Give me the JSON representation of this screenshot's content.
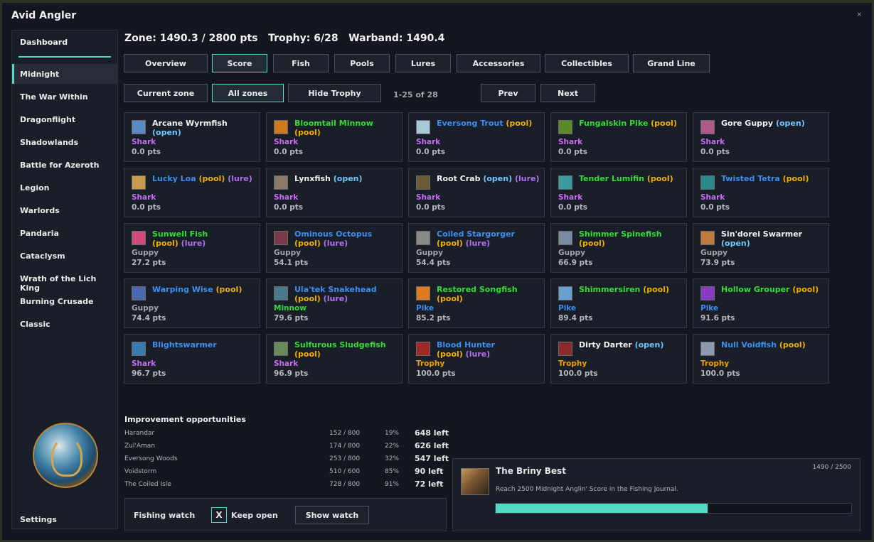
{
  "app": {
    "title": "Avid Angler",
    "close": "×"
  },
  "sidebar": {
    "dashboard": "Dashboard",
    "items": [
      "Midnight",
      "The War Within",
      "Dragonflight",
      "Shadowlands",
      "Battle for Azeroth",
      "Legion",
      "Warlords",
      "Pandaria",
      "Cataclysm",
      "Wrath of the Lich King",
      "Burning Crusade",
      "Classic"
    ],
    "active": "Midnight",
    "settings": "Settings"
  },
  "header": {
    "text": "Zone: 1490.3 / 2800 pts   Trophy: 6/28   Warband: 1490.4"
  },
  "tabs": [
    "Overview",
    "Score",
    "Fish",
    "Pools",
    "Lures",
    "Accessories",
    "Collectibles",
    "Grand Line"
  ],
  "active_tab": "Score",
  "filters": {
    "current_zone": "Current zone",
    "all_zones": "All zones",
    "hide_trophy": "Hide Trophy",
    "page_info": "1-25 of 28",
    "prev": "Prev",
    "next": "Next"
  },
  "colors": {
    "accent": "#55d8c6",
    "shark": "#c86cf0",
    "guppy": "#a0a4ad",
    "minnow": "#33dd33",
    "pike": "#3c8ff0",
    "trophy": "#f0a000",
    "open": "#6ec8ff",
    "pool": "#f0b000",
    "lure": "#b070f0",
    "name_white": "#f2f2f2",
    "name_blue": "#3c8ff0",
    "name_green": "#33dd33"
  },
  "fish": [
    {
      "name": "Arcane Wyrmfish",
      "color": "white",
      "tags": [
        {
          "t": "(open)",
          "k": "open"
        }
      ],
      "wrap": true,
      "cat": "Shark",
      "pts": "0.0 pts",
      "icon": "#5a8ac0"
    },
    {
      "name": "Bloomtail Minnow",
      "color": "green",
      "tags": [
        {
          "t": "(pool)",
          "k": "pool"
        }
      ],
      "wrap": false,
      "cat": "Shark",
      "pts": "0.0 pts",
      "icon": "#d07a20"
    },
    {
      "name": "Eversong Trout",
      "color": "blue",
      "tags": [
        {
          "t": "(pool)",
          "k": "pool"
        }
      ],
      "wrap": false,
      "cat": "Shark",
      "pts": "0.0 pts",
      "icon": "#a8c8d8"
    },
    {
      "name": "Fungalskin Pike",
      "color": "green",
      "tags": [
        {
          "t": "(pool)",
          "k": "pool"
        }
      ],
      "wrap": false,
      "cat": "Shark",
      "pts": "0.0 pts",
      "icon": "#5a8a2a"
    },
    {
      "name": "Gore Guppy",
      "color": "white",
      "tags": [
        {
          "t": "(open)",
          "k": "open"
        }
      ],
      "wrap": false,
      "cat": "Shark",
      "pts": "0.0 pts",
      "icon": "#b05a8a"
    },
    {
      "name": "Lucky Loa",
      "color": "blue",
      "tags": [
        {
          "t": "(pool)",
          "k": "pool"
        },
        {
          "t": "(lure)",
          "k": "lure"
        }
      ],
      "wrap": false,
      "cat": "Shark",
      "pts": "0.0 pts",
      "icon": "#c89a50"
    },
    {
      "name": "Lynxfish",
      "color": "white",
      "tags": [
        {
          "t": "(open)",
          "k": "open"
        }
      ],
      "wrap": false,
      "cat": "Shark",
      "pts": "0.0 pts",
      "icon": "#8a7a6a"
    },
    {
      "name": "Root Crab",
      "color": "white",
      "tags": [
        {
          "t": "(open)",
          "k": "open"
        },
        {
          "t": "(lure)",
          "k": "lure"
        }
      ],
      "wrap": false,
      "cat": "Shark",
      "pts": "0.0 pts",
      "icon": "#6a5a3a"
    },
    {
      "name": "Tender Lumifin",
      "color": "green",
      "tags": [
        {
          "t": "(pool)",
          "k": "pool"
        }
      ],
      "wrap": false,
      "cat": "Shark",
      "pts": "0.0 pts",
      "icon": "#3a9aa0"
    },
    {
      "name": "Twisted Tetra",
      "color": "blue",
      "tags": [
        {
          "t": "(pool)",
          "k": "pool"
        }
      ],
      "wrap": false,
      "cat": "Shark",
      "pts": "0.0 pts",
      "icon": "#2a8a8a"
    },
    {
      "name": "Sunwell Fish",
      "color": "green",
      "tags": [
        {
          "t": "(pool)",
          "k": "pool"
        },
        {
          "t": "(lure)",
          "k": "lure"
        }
      ],
      "wrap": true,
      "cat": "Guppy",
      "pts": "27.2 pts",
      "icon": "#d04a7a"
    },
    {
      "name": "Ominous Octopus",
      "color": "blue",
      "tags": [
        {
          "t": "(pool)",
          "k": "pool"
        },
        {
          "t": "(lure)",
          "k": "lure"
        }
      ],
      "wrap": true,
      "cat": "Guppy",
      "pts": "54.1 pts",
      "icon": "#7a3a4a"
    },
    {
      "name": "Coiled Stargorger",
      "color": "blue",
      "tags": [
        {
          "t": "(pool)",
          "k": "pool"
        },
        {
          "t": "(lure)",
          "k": "lure"
        }
      ],
      "wrap": true,
      "cat": "Guppy",
      "pts": "54.4 pts",
      "icon": "#8a8a8a"
    },
    {
      "name": "Shimmer Spinefish",
      "color": "green",
      "tags": [
        {
          "t": "(pool)",
          "k": "pool"
        }
      ],
      "wrap": true,
      "cat": "Guppy",
      "pts": "66.9 pts",
      "icon": "#7a8aa0"
    },
    {
      "name": "Sin'dorei Swarmer",
      "color": "white",
      "tags": [
        {
          "t": "(open)",
          "k": "open"
        }
      ],
      "wrap": true,
      "cat": "Guppy",
      "pts": "73.9 pts",
      "icon": "#c07a3a"
    },
    {
      "name": "Warping Wise",
      "color": "blue",
      "tags": [
        {
          "t": "(pool)",
          "k": "pool"
        }
      ],
      "wrap": false,
      "cat": "Guppy",
      "pts": "74.4 pts",
      "icon": "#4a6ab0"
    },
    {
      "name": "Ula'tek Snakehead",
      "color": "blue",
      "tags": [
        {
          "t": "(pool)",
          "k": "pool"
        },
        {
          "t": "(lure)",
          "k": "lure"
        }
      ],
      "wrap": true,
      "cat": "Minnow",
      "pts": "79.6 pts",
      "icon": "#4a7a8a"
    },
    {
      "name": "Restored Songfish",
      "color": "green",
      "tags": [
        {
          "t": "(pool)",
          "k": "pool"
        }
      ],
      "wrap": true,
      "cat": "Pike",
      "pts": "85.2 pts",
      "icon": "#e07a20"
    },
    {
      "name": "Shimmersiren",
      "color": "green",
      "tags": [
        {
          "t": "(pool)",
          "k": "pool"
        }
      ],
      "wrap": false,
      "cat": "Pike",
      "pts": "89.4 pts",
      "icon": "#6aa0d0"
    },
    {
      "name": "Hollow Grouper",
      "color": "green",
      "tags": [
        {
          "t": "(pool)",
          "k": "pool"
        }
      ],
      "wrap": false,
      "cat": "Pike",
      "pts": "91.6 pts",
      "icon": "#8a3ac0"
    },
    {
      "name": "Blightswarmer",
      "color": "blue",
      "tags": [],
      "wrap": false,
      "cat": "Shark",
      "pts": "96.7 pts",
      "icon": "#3a7ab0"
    },
    {
      "name": "Sulfurous Sludgefish",
      "color": "green",
      "tags": [
        {
          "t": "(pool)",
          "k": "pool"
        }
      ],
      "wrap": true,
      "cat": "Shark",
      "pts": "96.9 pts",
      "icon": "#6a8a5a"
    },
    {
      "name": "Blood Hunter",
      "color": "blue",
      "tags": [
        {
          "t": "(pool)",
          "k": "pool"
        },
        {
          "t": "(lure)",
          "k": "lure"
        }
      ],
      "wrap": true,
      "cat": "Trophy",
      "pts": "100.0 pts",
      "icon": "#a02a2a"
    },
    {
      "name": "Dirty Darter",
      "color": "white",
      "tags": [
        {
          "t": "(open)",
          "k": "open"
        }
      ],
      "wrap": false,
      "cat": "Trophy",
      "pts": "100.0 pts",
      "icon": "#8a2a2a"
    },
    {
      "name": "Null Voidfish",
      "color": "blue",
      "tags": [
        {
          "t": "(pool)",
          "k": "pool"
        }
      ],
      "wrap": false,
      "cat": "Trophy",
      "pts": "100.0 pts",
      "icon": "#8a9ab0"
    }
  ],
  "improvement": {
    "title": "Improvement opportunities",
    "rows": [
      {
        "zone": "Harandar",
        "score": "152 / 800",
        "pct": "19%",
        "left": "648 left"
      },
      {
        "zone": "Zul'Aman",
        "score": "174 / 800",
        "pct": "22%",
        "left": "626 left"
      },
      {
        "zone": "Eversong Woods",
        "score": "253 / 800",
        "pct": "32%",
        "left": "547 left"
      },
      {
        "zone": "Voidstorm",
        "score": "510 / 600",
        "pct": "85%",
        "left": "90 left"
      },
      {
        "zone": "The Coiled Isle",
        "score": "728 / 800",
        "pct": "91%",
        "left": "72 left"
      }
    ]
  },
  "watch": {
    "label": "Fishing watch",
    "checkbox": "X",
    "keep_open": "Keep open",
    "show_watch": "Show watch"
  },
  "achievement": {
    "title": "The Briny Best",
    "desc": "Reach 2500 Midnight Anglin' Score in the Fishing Journal.",
    "count": "1490 / 2500",
    "progress": 0.596
  }
}
